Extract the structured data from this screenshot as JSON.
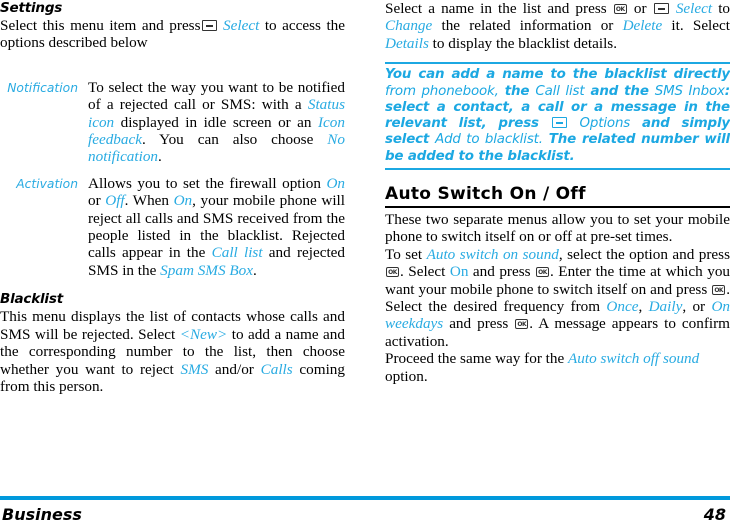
{
  "document": {
    "footer": {
      "section_label": "Business",
      "page_number": "48"
    },
    "accent_color": "#29ABE2",
    "rule_color": "#0099DC"
  },
  "left_column": {
    "settings": {
      "heading": "Settings",
      "intro_1": "Select this menu item and press",
      "intro_link": "Select",
      "intro_2": "to access the options described below",
      "rows": [
        {
          "term": "Notification",
          "parts": [
            {
              "t": "To select the way you want to be notified of a rejected call or SMS: with a ",
              "style": "plain"
            },
            {
              "t": "Status icon",
              "style": "blue"
            },
            {
              "t": " displayed in idle screen or an ",
              "style": "plain"
            },
            {
              "t": "Icon feedback",
              "style": "blue"
            },
            {
              "t": ". You can also choose ",
              "style": "plain"
            },
            {
              "t": "No notification",
              "style": "blue"
            },
            {
              "t": ".",
              "style": "plain"
            }
          ]
        },
        {
          "term": "Activation",
          "parts": [
            {
              "t": "Allows you to set the firewall option ",
              "style": "plain"
            },
            {
              "t": "On",
              "style": "blue"
            },
            {
              "t": " or ",
              "style": "plain"
            },
            {
              "t": "Off",
              "style": "blue"
            },
            {
              "t": ". When ",
              "style": "plain"
            },
            {
              "t": "On",
              "style": "blue"
            },
            {
              "t": ", your mobile phone will reject all calls and SMS received from the people listed in the blacklist. Rejected calls appear in the ",
              "style": "plain"
            },
            {
              "t": "Call list",
              "style": "blue"
            },
            {
              "t": " and rejected SMS in the ",
              "style": "plain"
            },
            {
              "t": "Spam SMS Box",
              "style": "blue"
            },
            {
              "t": ".",
              "style": "plain"
            }
          ]
        }
      ]
    },
    "blacklist": {
      "heading": "Blacklist",
      "para_parts": [
        {
          "t": "This menu displays the list of contacts whose calls and SMS will be rejected. Select ",
          "style": "plain"
        },
        {
          "t": "<New>",
          "style": "blue"
        },
        {
          "t": " to add a name and the corresponding number to the list, then choose whether you want to reject ",
          "style": "plain"
        },
        {
          "t": "SMS",
          "style": "blue"
        },
        {
          "t": " and/or ",
          "style": "plain"
        },
        {
          "t": "Calls",
          "style": "blue"
        },
        {
          "t": " coming from this person.",
          "style": "plain"
        }
      ]
    }
  },
  "right_column": {
    "blacklist_cont": {
      "p1_a": "Select a name in the list and press",
      "p1_or": "or",
      "p1_select": "Select",
      "p1_b": "to",
      "p1_change": "Change",
      "p1_c": "the related information or",
      "p1_delete": "Delete",
      "p1_d": "it. Select",
      "p1_details": "Details",
      "p1_e": "to display the blacklist details."
    },
    "callout": {
      "l1_bold": "You can add a name to the blacklist directly",
      "l1_light": "from phonebook,",
      "l2_bold": "the",
      "l2_light": "Call list",
      "l2_bold2": "and the",
      "l2_light2": "SMS Inbox",
      "l2_bold3": ": select a contact, a call or a message in the relevant list, press",
      "l3_light": "Options",
      "l3_bold": "and simply select",
      "l3_light2": "Add to  blacklist.",
      "l4_bold": "The related number will be added to the blacklist."
    },
    "auto_switch": {
      "heading": "Auto Switch On / Off",
      "p1": "These two separate menus allow you to set your mobile phone to switch itself on or off at pre-set times.",
      "p2_a": "To set",
      "p2_blue1": "Auto switch on sound",
      "p2_b": ", select the option and press",
      "p2_c": ". Select",
      "p2_blue2": "On",
      "p2_d": "and press",
      "p2_e": ". Enter the time at which you want your mobile phone to switch itself on and press",
      "p2_f": ". Select the desired frequency from",
      "p2_blue3": "Once",
      "p2_blue4": "Daily",
      "p2_or": ", or",
      "p2_blue5": "On weekdays",
      "p2_g": "and press",
      "p2_h": ". A message appears to confirm activation.",
      "p3_a": "Proceed the same way for the",
      "p3_blue": "Auto switch off sound",
      "p3_b": "option."
    }
  },
  "icons": {
    "soft_key": "soft-key-icon",
    "ok_key": "ok-key-icon",
    "ok_key_label": "OK"
  }
}
